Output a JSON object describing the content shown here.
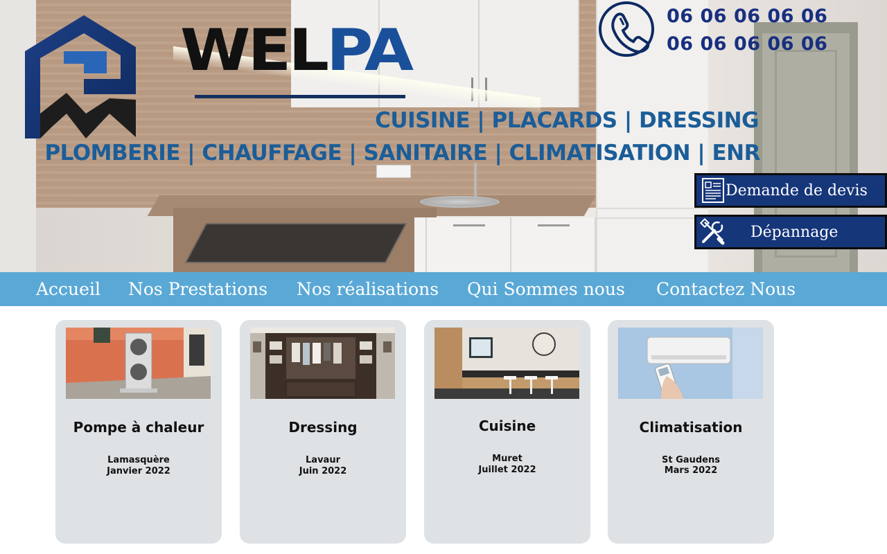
{
  "brand": {
    "part1": "WEL",
    "part2": "PA"
  },
  "taglines": {
    "line1": "CUISINE | PLACARDS | DRESSING",
    "line2": "PLOMBERIE | CHAUFFAGE | SANITAIRE | CLIMATISATION | ENR"
  },
  "phones": [
    "06 06 06 06 06",
    "06 06 06 06 06"
  ],
  "cta": {
    "quote_label": "Demande de devis",
    "repair_label": "Dépannage"
  },
  "nav": [
    "Accueil",
    "Nos Prestations",
    "Nos réalisations",
    "Qui Sommes nous",
    "Contactez Nous"
  ],
  "cards": [
    {
      "title": "Pompe à chaleur",
      "place": "Lamasquère",
      "date": "Janvier 2022"
    },
    {
      "title": "Dressing",
      "place": "Lavaur",
      "date": "Juin 2022"
    },
    {
      "title": "Cuisine",
      "place": "Muret",
      "date": "Juillet 2022"
    },
    {
      "title": "Climatisation",
      "place": "St Gaudens",
      "date": "Mars 2022"
    }
  ],
  "icons": {
    "phone": "phone-icon",
    "quote": "document-icon",
    "repair": "tools-icon"
  },
  "colors": {
    "brand_blue": "#1a4f9a",
    "navy": "#16367a",
    "nav_bar": "#5aa8d6",
    "card_bg": "#dfe2e5",
    "tagline": "#1b5d98"
  }
}
